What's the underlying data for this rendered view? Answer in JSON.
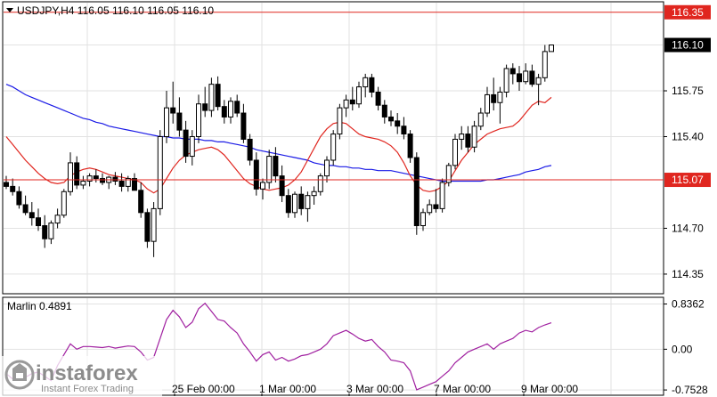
{
  "chart_data": [
    {
      "type": "candlestick",
      "title": "USDJPY,H4  116.05 116.10 116.05 116.10",
      "ylim": [
        114.2,
        116.43
      ],
      "y_ticks": [
        "116.10",
        "115.75",
        "115.40",
        "114.70",
        "114.35"
      ],
      "x_ticks": [
        "25 Feb 00:00",
        "1 Mar 00:00",
        "3 Mar 00:00",
        "7 Mar 00:00",
        "9 Mar 00:00"
      ],
      "hlines": [
        {
          "value": 116.35,
          "label": "116.35",
          "color": "#e0261f"
        },
        {
          "value": 115.07,
          "label": "115.07",
          "color": "#e0261f"
        }
      ],
      "current_price_label": "116.10",
      "candles": [
        [
          115.05,
          115.1,
          115.0,
          115.02
        ],
        [
          115.02,
          115.08,
          114.95,
          114.98
        ],
        [
          114.98,
          115.02,
          114.85,
          114.88
        ],
        [
          114.88,
          114.95,
          114.8,
          114.82
        ],
        [
          114.82,
          114.9,
          114.72,
          114.78
        ],
        [
          114.78,
          114.85,
          114.68,
          114.72
        ],
        [
          114.72,
          114.8,
          114.55,
          114.62
        ],
        [
          114.62,
          114.76,
          114.58,
          114.74
        ],
        [
          114.74,
          114.85,
          114.7,
          114.8
        ],
        [
          114.8,
          115.0,
          114.78,
          114.98
        ],
        [
          114.98,
          115.28,
          114.95,
          115.2
        ],
        [
          115.2,
          115.25,
          115.0,
          115.03
        ],
        [
          115.03,
          115.1,
          115.0,
          115.06
        ],
        [
          115.06,
          115.12,
          115.02,
          115.1
        ],
        [
          115.1,
          115.15,
          115.05,
          115.08
        ],
        [
          115.08,
          115.12,
          115.03,
          115.05
        ],
        [
          115.05,
          115.1,
          115.0,
          115.09
        ],
        [
          115.09,
          115.13,
          115.03,
          115.06
        ],
        [
          115.06,
          115.12,
          114.98,
          115.02
        ],
        [
          115.02,
          115.1,
          114.98,
          115.08
        ],
        [
          115.08,
          115.12,
          115.0,
          114.99
        ],
        [
          114.99,
          115.05,
          114.78,
          114.82
        ],
        [
          114.82,
          114.85,
          114.55,
          114.6
        ],
        [
          114.6,
          114.9,
          114.48,
          114.85
        ],
        [
          114.85,
          115.45,
          114.8,
          115.4
        ],
        [
          115.4,
          115.75,
          115.35,
          115.62
        ],
        [
          115.62,
          115.82,
          115.5,
          115.58
        ],
        [
          115.58,
          115.7,
          115.4,
          115.45
        ],
        [
          115.45,
          115.52,
          115.2,
          115.25
        ],
        [
          115.25,
          115.45,
          115.18,
          115.4
        ],
        [
          115.4,
          115.72,
          115.35,
          115.65
        ],
        [
          115.65,
          115.78,
          115.55,
          115.6
        ],
        [
          115.6,
          115.85,
          115.55,
          115.8
        ],
        [
          115.8,
          115.86,
          115.6,
          115.63
        ],
        [
          115.63,
          115.68,
          115.5,
          115.55
        ],
        [
          115.55,
          115.7,
          115.5,
          115.67
        ],
        [
          115.67,
          115.72,
          115.55,
          115.58
        ],
        [
          115.58,
          115.65,
          115.35,
          115.38
        ],
        [
          115.38,
          115.42,
          115.18,
          115.22
        ],
        [
          115.22,
          115.28,
          114.95,
          115.0
        ],
        [
          115.0,
          115.08,
          114.92,
          115.05
        ],
        [
          115.05,
          115.3,
          115.0,
          115.25
        ],
        [
          115.25,
          115.32,
          115.05,
          115.1
        ],
        [
          115.1,
          115.18,
          114.9,
          114.95
        ],
        [
          114.95,
          115.0,
          114.78,
          114.82
        ],
        [
          114.82,
          114.98,
          114.78,
          114.96
        ],
        [
          114.96,
          115.02,
          114.8,
          114.85
        ],
        [
          114.85,
          114.98,
          114.75,
          114.95
        ],
        [
          114.95,
          115.02,
          114.88,
          114.98
        ],
        [
          114.98,
          115.12,
          114.95,
          115.1
        ],
        [
          115.1,
          115.25,
          115.05,
          115.22
        ],
        [
          115.22,
          115.45,
          115.18,
          115.42
        ],
        [
          115.42,
          115.65,
          115.38,
          115.62
        ],
        [
          115.62,
          115.72,
          115.55,
          115.68
        ],
        [
          115.68,
          115.78,
          115.6,
          115.65
        ],
        [
          115.65,
          115.82,
          115.62,
          115.78
        ],
        [
          115.78,
          115.88,
          115.7,
          115.85
        ],
        [
          115.85,
          115.88,
          115.7,
          115.74
        ],
        [
          115.74,
          115.78,
          115.6,
          115.64
        ],
        [
          115.64,
          115.68,
          115.5,
          115.55
        ],
        [
          115.55,
          115.6,
          115.48,
          115.52
        ],
        [
          115.52,
          115.58,
          115.42,
          115.48
        ],
        [
          115.48,
          115.55,
          115.38,
          115.42
        ],
        [
          115.42,
          115.45,
          115.2,
          115.24
        ],
        [
          115.24,
          115.28,
          114.65,
          114.72
        ],
        [
          114.72,
          114.85,
          114.68,
          114.82
        ],
        [
          114.82,
          114.92,
          114.8,
          114.88
        ],
        [
          114.88,
          115.0,
          114.82,
          114.85
        ],
        [
          114.85,
          115.08,
          114.82,
          115.05
        ],
        [
          115.05,
          115.2,
          115.02,
          115.18
        ],
        [
          115.18,
          115.42,
          115.15,
          115.38
        ],
        [
          115.38,
          115.48,
          115.3,
          115.42
        ],
        [
          115.42,
          115.48,
          115.28,
          115.32
        ],
        [
          115.32,
          115.52,
          115.28,
          115.48
        ],
        [
          115.48,
          115.62,
          115.45,
          115.58
        ],
        [
          115.58,
          115.78,
          115.55,
          115.72
        ],
        [
          115.72,
          115.85,
          115.6,
          115.66
        ],
        [
          115.66,
          115.78,
          115.5,
          115.74
        ],
        [
          115.74,
          115.95,
          115.7,
          115.92
        ],
        [
          115.92,
          115.96,
          115.8,
          115.88
        ],
        [
          115.88,
          115.94,
          115.75,
          115.82
        ],
        [
          115.82,
          115.96,
          115.8,
          115.9
        ],
        [
          115.9,
          115.95,
          115.78,
          115.8
        ],
        [
          115.8,
          115.88,
          115.64,
          115.85
        ],
        [
          115.85,
          116.1,
          115.82,
          116.05
        ],
        [
          116.05,
          116.1,
          116.05,
          116.1
        ]
      ],
      "lines": [
        {
          "name": "",
          "color": "#1a1ae6",
          "start": 0,
          "values": [
            115.8,
            115.78,
            115.75,
            115.72,
            115.7,
            115.68,
            115.66,
            115.64,
            115.62,
            115.6,
            115.58,
            115.56,
            115.54,
            115.53,
            115.51,
            115.5,
            115.48,
            115.47,
            115.46,
            115.45,
            115.44,
            115.43,
            115.42,
            115.41,
            115.4,
            115.4,
            115.39,
            115.39,
            115.38,
            115.38,
            115.38,
            115.37,
            115.37,
            115.36,
            115.36,
            115.35,
            115.34,
            115.33,
            115.32,
            115.3,
            115.29,
            115.28,
            115.27,
            115.26,
            115.25,
            115.24,
            115.23,
            115.22,
            115.2,
            115.19,
            115.18,
            115.18,
            115.17,
            115.17,
            115.16,
            115.16,
            115.15,
            115.15,
            115.14,
            115.14,
            115.14,
            115.13,
            115.12,
            115.11,
            115.1,
            115.09,
            115.08,
            115.07,
            115.06,
            115.06,
            115.06,
            115.06,
            115.06,
            115.06,
            115.06,
            115.07,
            115.07,
            115.08,
            115.09,
            115.1,
            115.11,
            115.13,
            115.14,
            115.15,
            115.17,
            115.18
          ]
        },
        {
          "name": "",
          "color": "#e0261f",
          "start": 0,
          "values": [
            115.4,
            115.34,
            115.28,
            115.22,
            115.17,
            115.12,
            115.08,
            115.05,
            115.04,
            115.05,
            115.1,
            115.13,
            115.15,
            115.16,
            115.15,
            115.13,
            115.11,
            115.1,
            115.09,
            115.08,
            115.07,
            115.05,
            115.0,
            114.97,
            115.0,
            115.08,
            115.16,
            115.22,
            115.26,
            115.28,
            115.3,
            115.31,
            115.32,
            115.3,
            115.26,
            115.2,
            115.14,
            115.08,
            115.04,
            115.02,
            115.0,
            114.99,
            115.0,
            115.01,
            115.03,
            115.07,
            115.13,
            115.22,
            115.31,
            115.4,
            115.46,
            115.5,
            115.51,
            115.5,
            115.46,
            115.42,
            115.4,
            115.39,
            115.38,
            115.36,
            115.33,
            115.28,
            115.2,
            115.1,
            115.03,
            114.99,
            114.98,
            114.99,
            115.02,
            115.06,
            115.14,
            115.22,
            115.28,
            115.34,
            115.38,
            115.42,
            115.44,
            115.46,
            115.47,
            115.48,
            115.52,
            115.58,
            115.64,
            115.67,
            115.66,
            115.7
          ]
        }
      ]
    },
    {
      "type": "line",
      "title": "Marlin 0.4891",
      "ylim": [
        -0.85,
        0.96
      ],
      "y_ticks": [
        "0.8362",
        "0.00",
        "-0.7528"
      ],
      "series": [
        {
          "name": "Marlin",
          "color": "#a020a0",
          "values": [
            -0.45,
            -0.55,
            -0.48,
            -0.52,
            -0.45,
            -0.42,
            -0.5,
            -0.58,
            -0.3,
            -0.1,
            0.1,
            0.0,
            0.05,
            0.05,
            0.04,
            0.03,
            0.05,
            0.02,
            0.04,
            0.06,
            0.05,
            -0.05,
            -0.2,
            -0.15,
            0.2,
            0.55,
            0.72,
            0.6,
            0.4,
            0.5,
            0.75,
            0.85,
            0.7,
            0.55,
            0.52,
            0.4,
            0.3,
            0.1,
            -0.05,
            -0.22,
            -0.1,
            -0.05,
            -0.2,
            -0.15,
            -0.22,
            -0.18,
            -0.12,
            -0.1,
            -0.05,
            0.0,
            0.1,
            0.25,
            0.3,
            0.35,
            0.28,
            0.2,
            0.15,
            0.18,
            0.05,
            -0.05,
            -0.2,
            -0.22,
            -0.25,
            -0.4,
            -0.75,
            -0.7,
            -0.65,
            -0.6,
            -0.5,
            -0.4,
            -0.25,
            -0.15,
            -0.05,
            0.0,
            0.05,
            0.1,
            0.0,
            0.1,
            0.15,
            0.2,
            0.3,
            0.35,
            0.32,
            0.4,
            0.45,
            0.49
          ]
        }
      ]
    }
  ],
  "logo": {
    "brand": "instaforex",
    "tagline": "Instant Forex Trading"
  },
  "colors": {
    "up": "#ffffff",
    "down": "#000000",
    "grid": "#e2e2e2",
    "hline": "#e0261f",
    "price_marker": "#000000"
  }
}
